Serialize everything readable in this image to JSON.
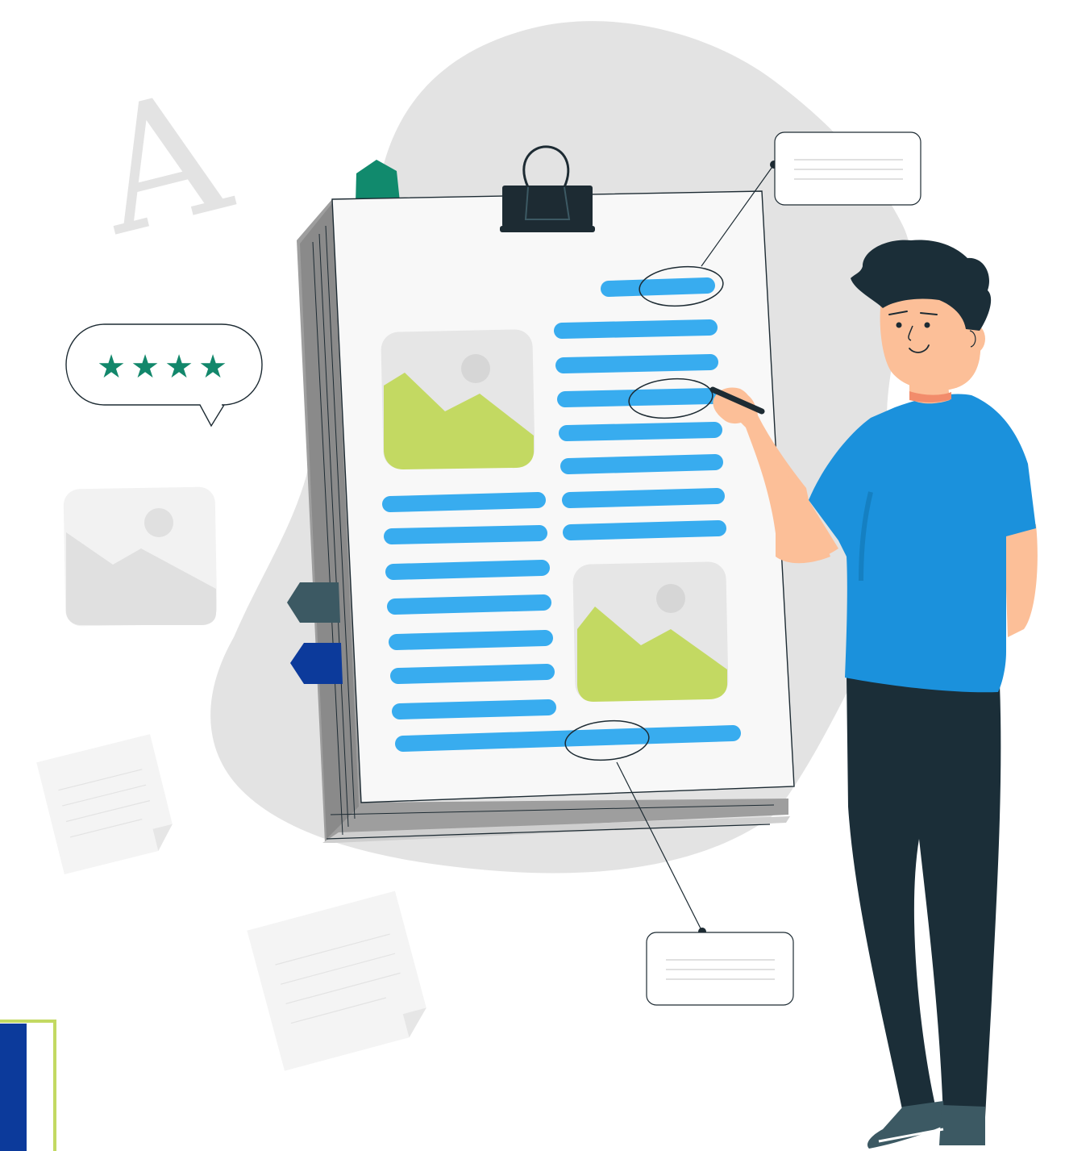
{
  "illustration": {
    "decorative_letter": "A",
    "rating_stars": [
      "★",
      "★",
      "★",
      "★"
    ],
    "colors": {
      "background": "#ffffff",
      "blob": "#e3e3e3",
      "text_lines": "#38acef",
      "image_placeholder_fill": "#c3d962",
      "shirt": "#1b91dc",
      "pants": "#1b2e38",
      "skin": "#fcbf98",
      "hair": "#1b2e38",
      "binder_clip": "#1d2b33",
      "tab_green": "#118a6d",
      "tab_slate": "#3c5963",
      "tab_navy": "#0c3a9b",
      "star": "#12876b",
      "corner_frame": "#c3d962"
    },
    "icons": [
      "binder-clip-icon",
      "star-icon",
      "image-placeholder-icon",
      "speech-bubble-icon",
      "callout-card-icon",
      "bookmark-tab-icon"
    ]
  }
}
